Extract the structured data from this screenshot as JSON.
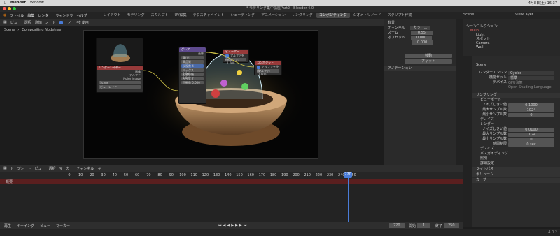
{
  "mac_menubar": {
    "app": "Blender",
    "items": [
      "Window"
    ],
    "right": "4月8日(土) 16:37"
  },
  "window_title": "* モデリング集中講座Part2 - Blender 4.0",
  "topbar": {
    "menus": [
      "ファイル",
      "編集",
      "レンダー",
      "ウィンドウ",
      "ヘルプ"
    ],
    "workspaces": [
      "レイアウト",
      "モデリング",
      "スカルプト",
      "UV編集",
      "テクスチャペイント",
      "シェーディング",
      "アニメーション",
      "レンダリング",
      "コンポジティング",
      "ジオメトリノード",
      "スクリプト作成"
    ],
    "active_workspace": "コンポジティング",
    "scene": "Scene",
    "view_layer": "ViewLayer"
  },
  "node_editor": {
    "header_menus": [
      "ビュー",
      "選択",
      "追加",
      "ノード"
    ],
    "use_nodes_label": "ノードを使用",
    "breadcrumb": [
      "Scene",
      "Compositing Nodetree"
    ],
    "nodes": {
      "render_layers": {
        "title": "レンダーレイヤー",
        "outputs": [
          "画像",
          "アルファ",
          "Noisy Image"
        ],
        "scene": "Scene",
        "layer": "ビューレイヤー"
      },
      "glare": {
        "title": "グレア",
        "lines": [
          "画像",
          "霧(光)",
          "高品質",
          "反復数",
          "ミックス",
          "しきい値",
          "サイズ",
          "回転数"
        ],
        "fields": [
          "4",
          "0.000",
          "1.000",
          "7",
          "0.000"
        ]
      },
      "viewer": {
        "title": "ビューアー",
        "alpha_label": "アルファを使用",
        "alpha_value": "アルファ: 1.000"
      },
      "composite": {
        "title": "コンポジット",
        "alpha_label": "アルファを使用",
        "alpha_value": "アルファ: 1.000"
      }
    },
    "side_panel": {
      "backdrop": "背景",
      "channels_label": "チャンネル",
      "channels_value": "カラー...",
      "zoom_label": "ズーム",
      "zoom_value": "0.55",
      "offset_x_label": "オフセット",
      "offset_x_value": "0.000",
      "offset_y_value": "0.000",
      "move_button": "移動",
      "fit_button": "フィット",
      "annotation": "アノテーション"
    }
  },
  "outliner": {
    "title": "シーンコレクション",
    "items": [
      "Main",
      "Light",
      "スポット",
      "Camera",
      "Wall",
      "テーブル"
    ]
  },
  "properties": {
    "scene_label": "Scene",
    "render_engine_label": "レンダーエンジン",
    "render_engine": "Cycles",
    "feature_set_label": "機能セット",
    "feature_set": "標準",
    "device_label": "デバイス",
    "device": "GPU演算",
    "osl_label": "Open Shading Language",
    "sampling": "サンプリング",
    "viewport": "ビューポート",
    "noise_threshold_label": "ノイズしきい値",
    "vp_noise_threshold": "0.1000",
    "max_samples_label": "最大サンプル数",
    "vp_max_samples": "1024",
    "min_samples_label": "最小サンプル数",
    "vp_min_samples": "0",
    "denoise": "デノイズ",
    "render": "レンダー",
    "r_noise_threshold": "0.0100",
    "r_max_samples": "1024",
    "r_min_samples": "0",
    "time_limit_label": "時間制限",
    "r_time_limit": "0 sec",
    "sections": [
      "デノイズ",
      "パスガイディング",
      "照明",
      "詳細設定",
      "ライトパス",
      "ボリューム",
      "カーブ"
    ]
  },
  "timeline": {
    "mode": "ドープシート",
    "menus": [
      "ビュー",
      "選択",
      "マーカー",
      "チャンネル",
      "キー"
    ],
    "summary": "概要",
    "ticks": [
      "0",
      "10",
      "20",
      "30",
      "40",
      "50",
      "60",
      "70",
      "80",
      "90",
      "100",
      "110",
      "120",
      "130",
      "140",
      "150",
      "160",
      "170",
      "180",
      "190",
      "200",
      "210",
      "220",
      "230",
      "240",
      "250"
    ],
    "current_frame": "220",
    "playback_label": "再生",
    "keying_label": "キーイング",
    "view_label": "ビュー",
    "marker_label": "マーカー",
    "frame_display": "220",
    "start_label": "開始",
    "start": "1",
    "end_label": "終了",
    "end": "250"
  },
  "status": {
    "version": "4.0.2"
  }
}
